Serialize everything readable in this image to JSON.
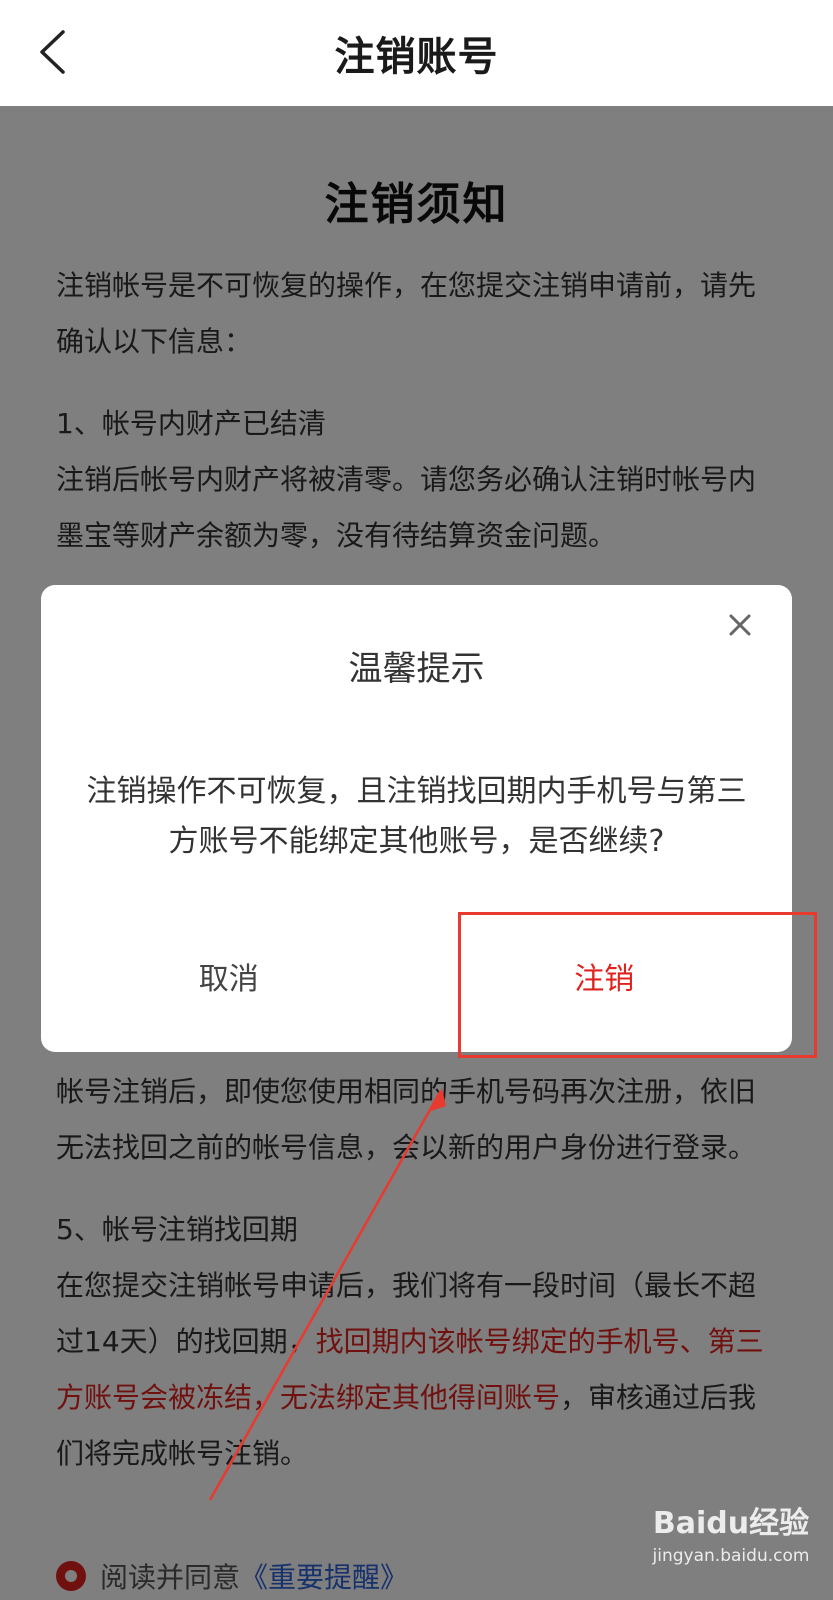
{
  "header": {
    "title": "注销账号"
  },
  "notice": {
    "title": "注销须知",
    "intro": "注销帐号是不可恢复的操作，在您提交注销申请前，请先确认以下信息：",
    "section1_head": "1、帐号内财产已结清",
    "section1_body": "注销后帐号内财产将被清零。请您务必确认注销时帐号内墨宝等财产余额为零，没有待结算资金问题。",
    "section4_body": "帐号注销后，即使您使用相同的手机号码再次注册，依旧无法找回之前的帐号信息，会以新的用户身份进行登录。",
    "section5_head": "5、帐号注销找回期",
    "section5_body_a": "在您提交注销帐号申请后，我们将有一段时间（最长不超过14天）的找回期，",
    "section5_body_red": "找回期内该帐号绑定的手机号、第三方账号会被冻结，无法绑定其他得间账号",
    "section5_body_b": "，审核通过后我们将完成帐号注销。",
    "agree_prefix": "阅读并同意",
    "agree_link": "《重要提醒》"
  },
  "dialog": {
    "title": "温馨提示",
    "message": "注销操作不可恢复，且注销找回期内手机号与第三方账号不能绑定其他账号，是否继续?",
    "cancel_label": "取消",
    "confirm_label": "注销"
  },
  "watermark": {
    "main": "Baidu经验",
    "sub": "jingyan.baidu.com"
  },
  "colors": {
    "accent_red": "#e0221f",
    "link_blue": "#2f62d8",
    "annotation_red": "#e83a2f"
  }
}
